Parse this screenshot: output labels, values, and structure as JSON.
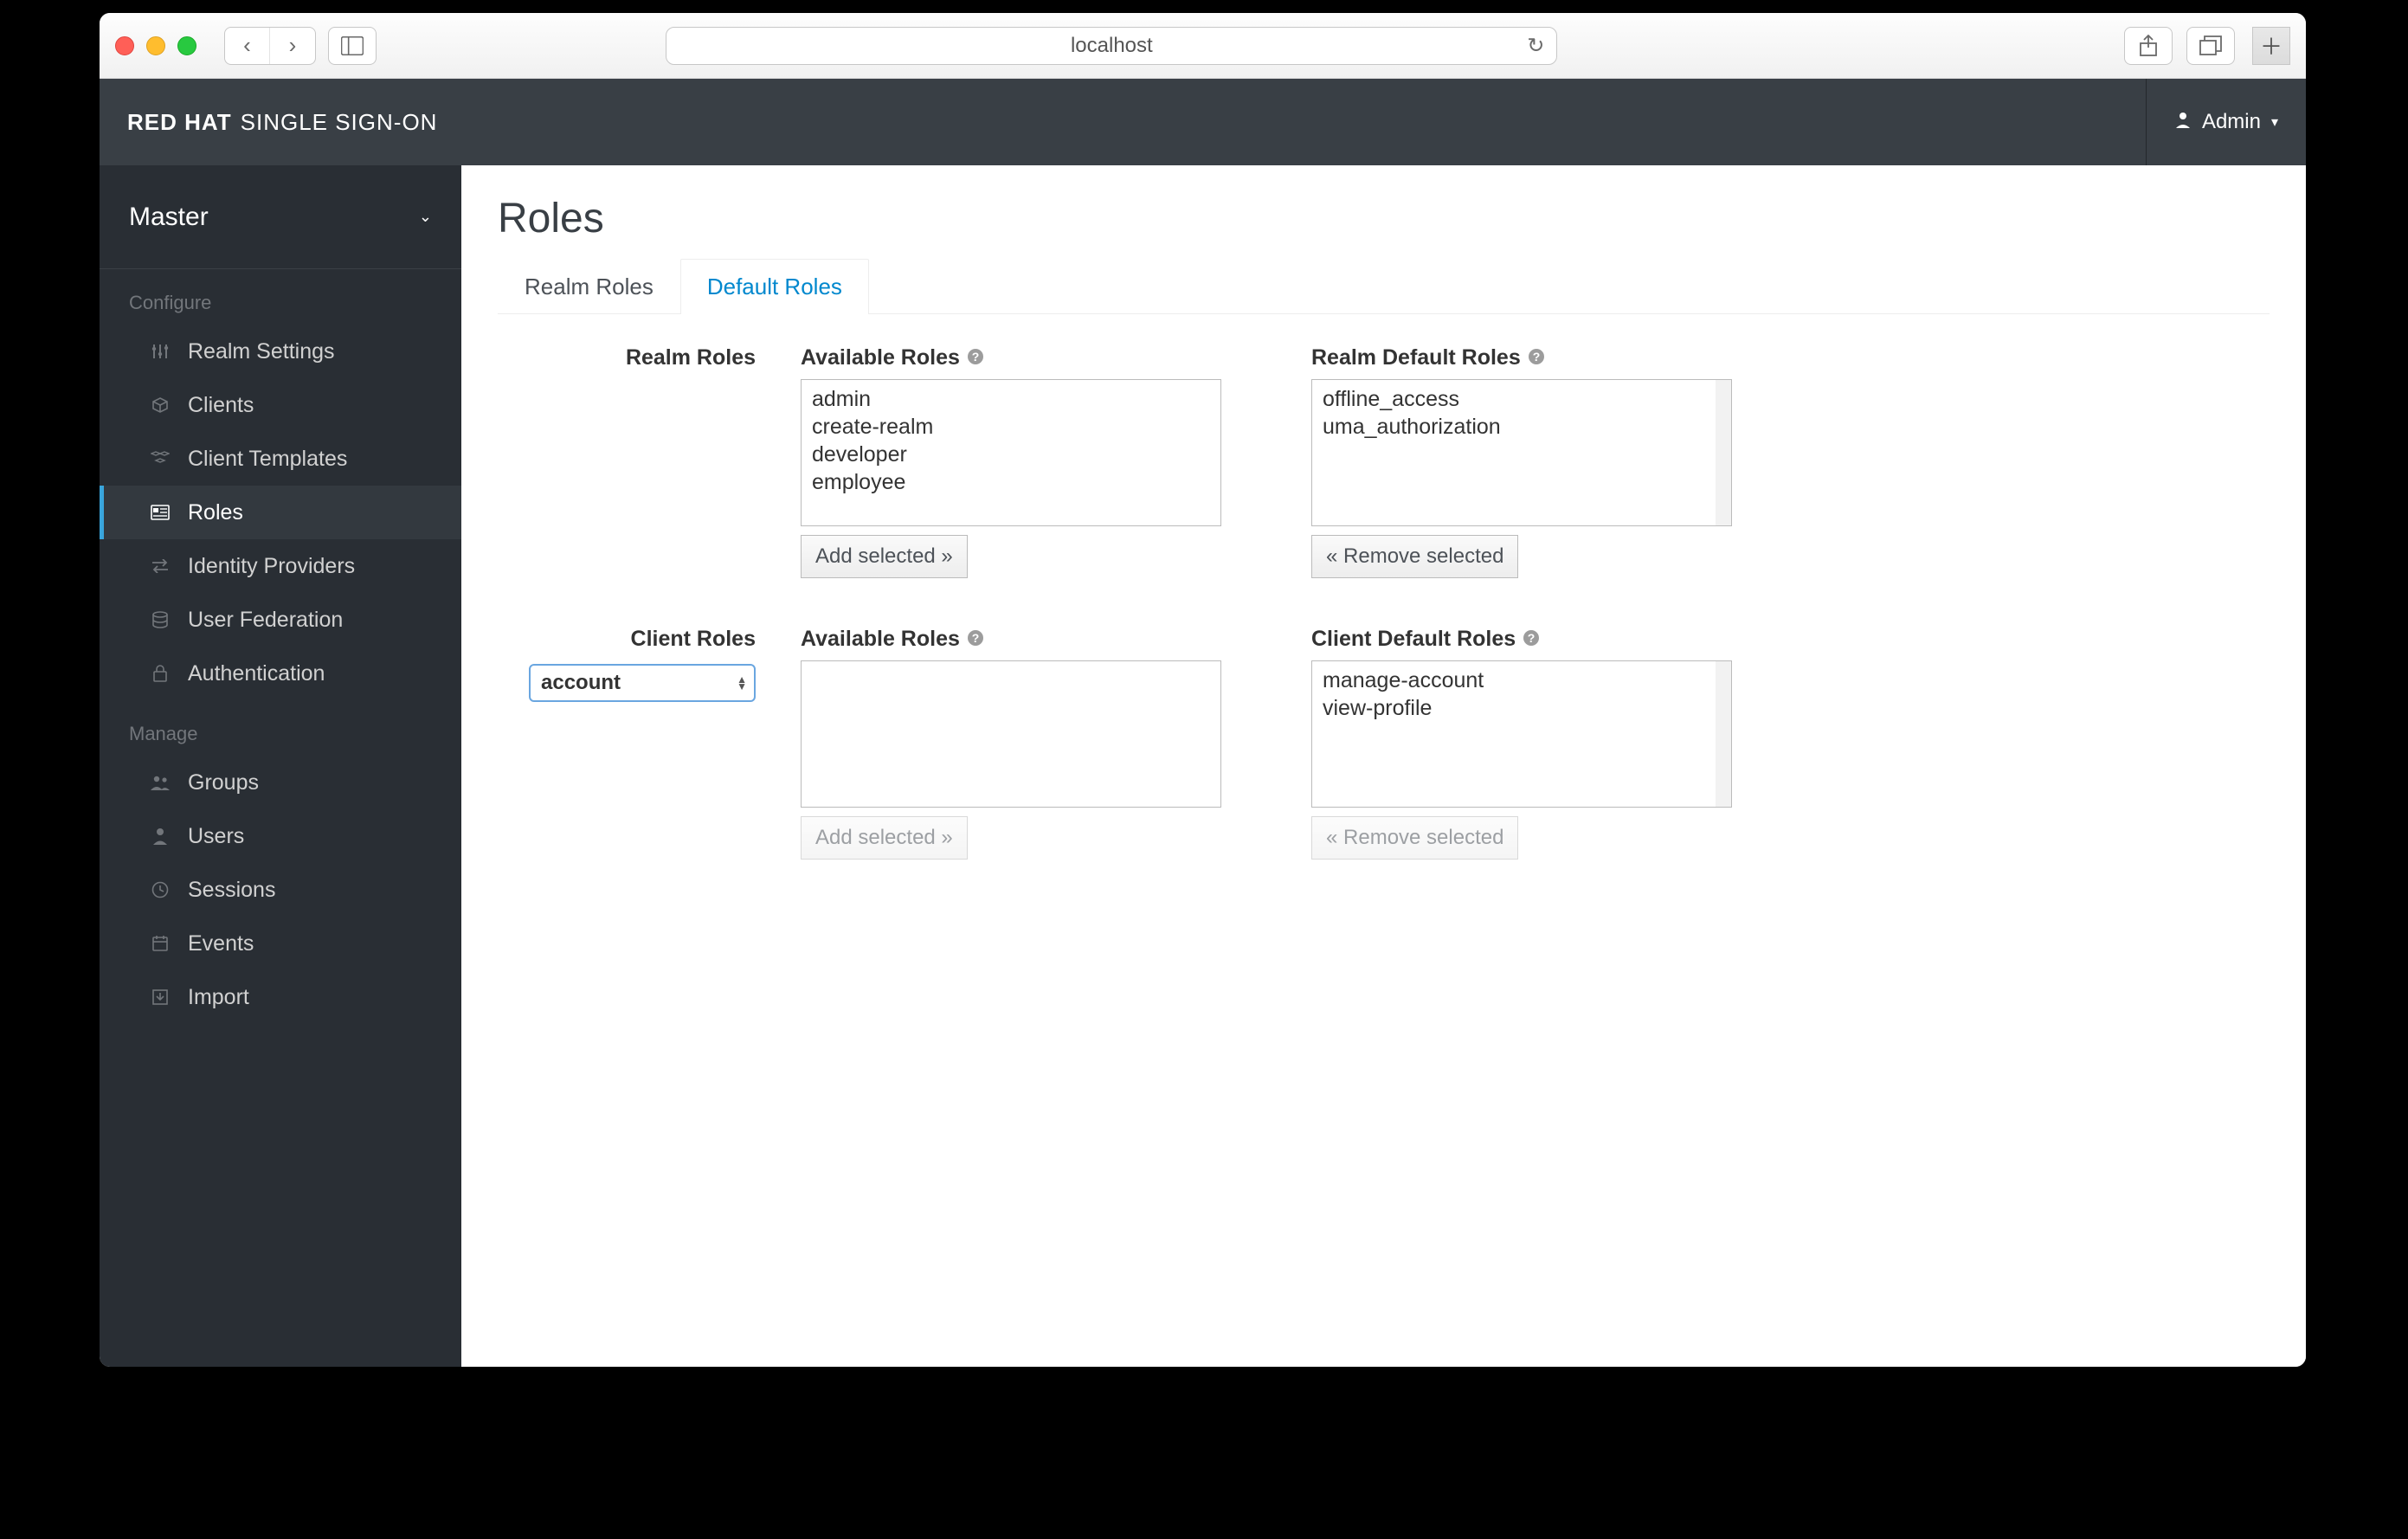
{
  "browser": {
    "url": "localhost"
  },
  "header": {
    "brand_bold": "RED HAT",
    "brand_rest": "SINGLE SIGN-ON",
    "user": "Admin"
  },
  "sidebar": {
    "realm": "Master",
    "sections": {
      "configure": {
        "label": "Configure",
        "items": [
          {
            "label": "Realm Settings"
          },
          {
            "label": "Clients"
          },
          {
            "label": "Client Templates"
          },
          {
            "label": "Roles"
          },
          {
            "label": "Identity Providers"
          },
          {
            "label": "User Federation"
          },
          {
            "label": "Authentication"
          }
        ]
      },
      "manage": {
        "label": "Manage",
        "items": [
          {
            "label": "Groups"
          },
          {
            "label": "Users"
          },
          {
            "label": "Sessions"
          },
          {
            "label": "Events"
          },
          {
            "label": "Import"
          }
        ]
      }
    }
  },
  "main": {
    "title": "Roles",
    "tabs": [
      {
        "label": "Realm Roles"
      },
      {
        "label": "Default Roles"
      }
    ],
    "realm_roles": {
      "label": "Realm Roles",
      "available_label": "Available Roles",
      "assigned_label": "Realm Default Roles",
      "available": [
        "admin",
        "create-realm",
        "developer",
        "employee"
      ],
      "assigned": [
        "offline_access",
        "uma_authorization"
      ],
      "add_btn": "Add selected »",
      "remove_btn": "« Remove selected"
    },
    "client_roles": {
      "label": "Client Roles",
      "client_select": "account",
      "available_label": "Available Roles",
      "assigned_label": "Client Default Roles",
      "available": [],
      "assigned": [
        "manage-account",
        "view-profile"
      ],
      "add_btn": "Add selected »",
      "remove_btn": "« Remove selected"
    }
  }
}
